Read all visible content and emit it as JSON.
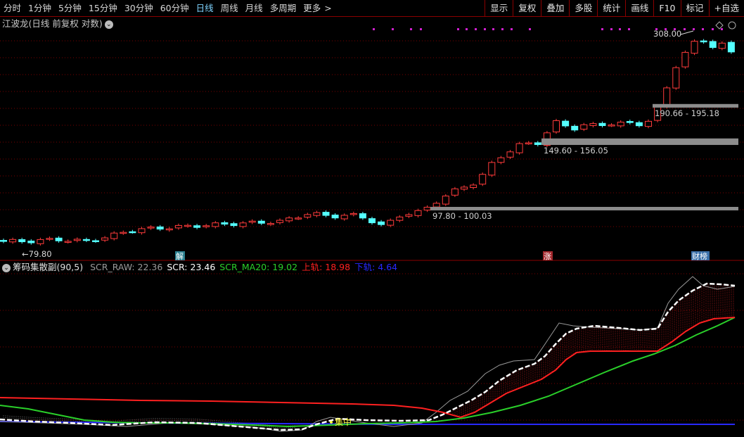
{
  "toolbar": {
    "periods": [
      "分时",
      "1分钟",
      "5分钟",
      "15分钟",
      "30分钟",
      "60分钟",
      "日线",
      "周线",
      "月线",
      "多周期",
      "更多"
    ],
    "active_period": "日线",
    "more_arrow": ">",
    "right_buttons": [
      "显示",
      "复权",
      "叠加",
      "多股",
      "统计",
      "画线",
      "F10",
      "标记",
      "+自选"
    ]
  },
  "main_chart": {
    "stock_name": "江波龙",
    "title_suffix": "(日线 前复权 对数)",
    "dropdown_icon": "chevron-down-icon",
    "high_marker": "308.00",
    "low_marker": "79.80",
    "low_arrow": "←",
    "zones": [
      "97.80 - 100.03",
      "149.60 - 156.05",
      "190.66 - 195.18"
    ],
    "event_badges": [
      {
        "text": "解",
        "color": "#2a7f8f"
      },
      {
        "text": "涨",
        "color": "#a3282d"
      },
      {
        "text": "财榜",
        "color": "#3a6fa8"
      }
    ],
    "top_icons": [
      "diamond-icon",
      "circle-icon"
    ],
    "colors": {
      "up": "#ff3b3b",
      "down": "#54ffff",
      "zone": "#8c8c8c",
      "grid": "#7a0000",
      "dots": "#d020d0"
    }
  },
  "indicator": {
    "name": "筹码集散副",
    "params": "(90,5)",
    "values": [
      {
        "label": "SCR_RAW",
        "value": "22.36",
        "color": "#9a9a9a"
      },
      {
        "label": "SCR",
        "value": "23.46",
        "color": "#ffffff"
      },
      {
        "label": "SCR_MA20",
        "value": "19.02",
        "color": "#2ad02a"
      },
      {
        "label": "上轨",
        "value": "18.98",
        "color": "#ff2020"
      },
      {
        "label": "下轨",
        "value": "4.64",
        "color": "#2828ff"
      }
    ],
    "annotation": "集中",
    "annotation_color": "#ffff40"
  },
  "chart_data": {
    "type": "candlestick",
    "title": "江波龙(日线 前复权 对数)",
    "y_scale": "log",
    "labeled_prices": {
      "high": 308.0,
      "low": 79.8
    },
    "support_zones": [
      [
        97.8,
        100.03
      ],
      [
        149.6,
        156.05
      ],
      [
        190.66,
        195.18
      ]
    ],
    "indicator_series": [
      {
        "name": "SCR_RAW",
        "last": 22.36
      },
      {
        "name": "SCR",
        "last": 23.46
      },
      {
        "name": "SCR_MA20",
        "last": 19.02
      },
      {
        "name": "上轨",
        "last": 18.98
      },
      {
        "name": "下轨",
        "last": 4.64
      }
    ]
  }
}
